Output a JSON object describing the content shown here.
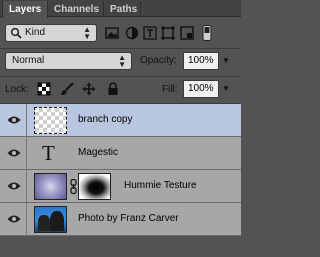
{
  "tabs": [
    {
      "label": "Layers",
      "active": true
    },
    {
      "label": "Channels",
      "active": false
    },
    {
      "label": "Paths",
      "active": false
    }
  ],
  "filter": {
    "kind_label": "Kind",
    "icons": [
      "pixel-layer-filter-icon",
      "adjustment-layer-filter-icon",
      "type-layer-filter-icon",
      "shape-layer-filter-icon",
      "smart-object-filter-icon"
    ]
  },
  "blend": {
    "mode": "Normal",
    "opacity_label": "Opacity:",
    "opacity_value": "100%"
  },
  "lock": {
    "label": "Lock:",
    "fill_label": "Fill:",
    "fill_value": "100%"
  },
  "layers": [
    {
      "name": "branch copy",
      "selected": true,
      "visible": true,
      "kind": "pixel"
    },
    {
      "name": "Magestic",
      "selected": false,
      "visible": true,
      "kind": "type"
    },
    {
      "name": "Hummie Testure",
      "selected": false,
      "visible": true,
      "kind": "masked"
    },
    {
      "name": "Photo by Franz Carver",
      "selected": false,
      "visible": true,
      "kind": "photo"
    }
  ],
  "colors": {
    "panel_bg": "#535353",
    "layer_bg": "#a7a7a7",
    "layer_selected_bg": "#b9c6df"
  }
}
